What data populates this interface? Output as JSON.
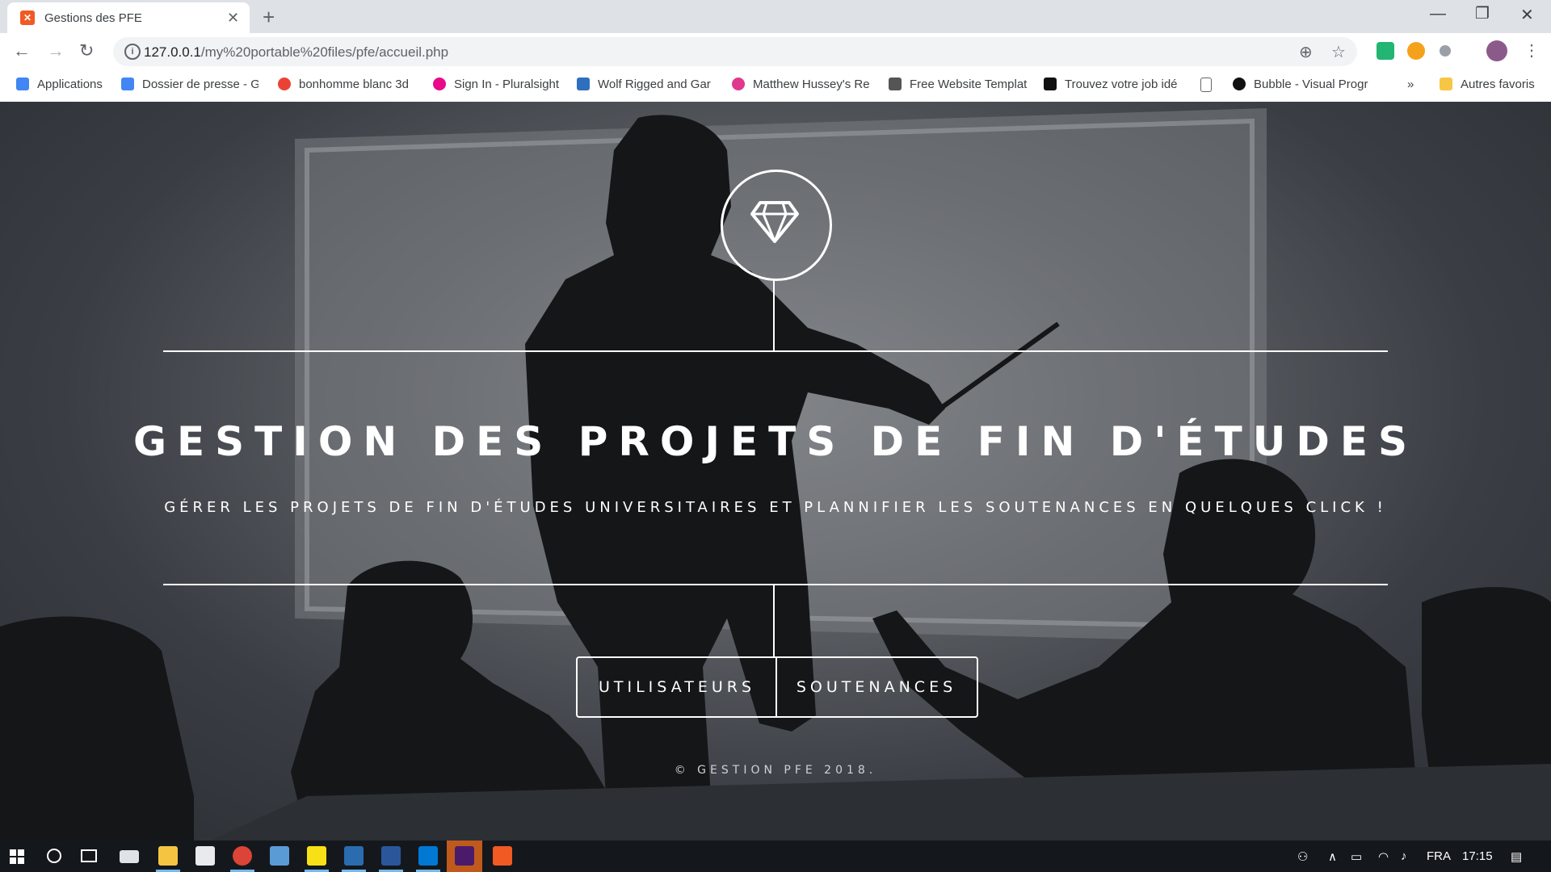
{
  "browser": {
    "tab_title": "Gestions des PFE",
    "tab_favicon": "xampp-icon",
    "url_host": "127.0.0.1",
    "url_path": "/my%20portable%20files/pfe/accueil.php",
    "bookmarks": [
      {
        "label": "Applications",
        "icon": "apps-grid-icon",
        "color": "#4285f4"
      },
      {
        "label": "Dossier de presse - G",
        "icon": "docs-icon",
        "color": "#4285f4"
      },
      {
        "label": "bonhomme blanc 3d",
        "icon": "google-icon",
        "color": "#ea4335"
      },
      {
        "label": "Sign In - Pluralsight",
        "icon": "pluralsight-icon",
        "color": "#e80a89"
      },
      {
        "label": "Wolf Rigged and Gar",
        "icon": "3d-icon",
        "color": "#2e6fbf"
      },
      {
        "label": "Matthew Hussey's Re",
        "icon": "hussey-icon",
        "color": "#e0388f"
      },
      {
        "label": "Free Website Templat",
        "icon": "ost-icon",
        "color": "#555555"
      },
      {
        "label": "Trouvez votre job idé",
        "icon": "w-icon",
        "color": "#111111"
      },
      {
        "label": "",
        "icon": "page-icon",
        "color": "#666666"
      },
      {
        "label": "Bubble - Visual Progr",
        "icon": "bubble-icon",
        "color": "#111111"
      }
    ],
    "bookmarks_overflow": "»",
    "other_bookmarks": "Autres favoris"
  },
  "hero": {
    "title": "GESTION DES PROJETS DE FIN D'ÉTUDES",
    "subtitle": "GÉRER LES PROJETS DE FIN D'ÉTUDES UNIVERSITAIRES ET PLANNIFIER LES SOUTENANCES EN QUELQUES CLICK !",
    "icon": "diamond-icon",
    "buttons": [
      {
        "label": "UTILISATEURS"
      },
      {
        "label": "SOUTENANCES"
      }
    ],
    "footer": "© GESTION PFE 2018."
  },
  "taskbar": {
    "language": "FRA",
    "time": "17:15"
  }
}
